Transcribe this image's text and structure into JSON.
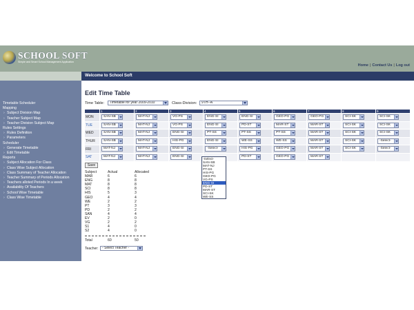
{
  "header": {
    "logo_name": "SCHOOL",
    "logo_name2": "SOFT",
    "tagline": "Simple and Smart School Management Application",
    "links": [
      "Home",
      "Contact Us",
      "Log out"
    ],
    "welcome": "Welcome to School Soft"
  },
  "sidebar": {
    "items": [
      {
        "label": "Timetable Scheduler",
        "level": 0
      },
      {
        "label": "Mapping",
        "level": 0
      },
      {
        "label": "Subject Division Map",
        "level": 1
      },
      {
        "label": "Teacher Subject Map",
        "level": 1
      },
      {
        "label": "Teacher Division Subject Map",
        "level": 1
      },
      {
        "label": "Rules Settings",
        "level": 0
      },
      {
        "label": "Rules Definition",
        "level": 1
      },
      {
        "label": "Parameters",
        "level": 1
      },
      {
        "label": "Scheduler",
        "level": 0
      },
      {
        "label": "Generate Timetable",
        "level": 1
      },
      {
        "label": "Edit Timetable",
        "level": 1
      },
      {
        "label": "Reports",
        "level": 0
      },
      {
        "label": "Subject Allocation For Class",
        "level": 1
      },
      {
        "label": "Class Wise Subject Allocation",
        "level": 1
      },
      {
        "label": "Class Summary of Teacher Allocation",
        "level": 1
      },
      {
        "label": "Teacher Summary of Periods Allocation",
        "level": 1
      },
      {
        "label": "Teachers alloted Periods In a week",
        "level": 1
      },
      {
        "label": "Availability Of Teachers",
        "level": 1
      },
      {
        "label": "School Wise Timetable",
        "level": 1
      },
      {
        "label": "Class Wise Timetable",
        "level": 1
      }
    ]
  },
  "main": {
    "title": "Edit Time Table",
    "timetable_label": "Time Table:",
    "timetable_value": "Timetable for year 2009-2010",
    "division_label": "Class-Division:",
    "division_value": "9TH--A",
    "periods": [
      "1",
      "2",
      "3",
      "4",
      "5",
      "6",
      "7",
      "8",
      "9"
    ],
    "rows": [
      {
        "day": "MON",
        "cells": [
          "SAN-SB",
          "MAT-NJ",
          "VG-PS",
          "ENG-SI",
          "ENG-SI",
          "GEO-PG",
          "GEO-PG",
          "SCI-SK",
          "SCI-SK"
        ]
      },
      {
        "day": "TUE",
        "cells": [
          "SAN-SB",
          "MAT-NJ",
          "VG-PS",
          "ENG-SI",
          "PD-ST",
          "MAR-ST",
          "MAR-ST",
          "SCI-SK",
          "SCI-SK"
        ]
      },
      {
        "day": "WED",
        "cells": [
          "SAN-SB",
          "MAT-NJ",
          "ENG-SI",
          "PT-SS",
          "PT-SS",
          "PT-SS",
          "MAR-ST",
          "SCI-SK",
          "SCI-SK"
        ]
      },
      {
        "day": "THUR",
        "cells": [
          "SAN-SB",
          "MAT-NJ",
          "HIS-PG",
          "ENG-SI",
          "WE-SS",
          "WE-SS",
          "MAR-ST",
          "SCI-SK",
          "-Select-"
        ]
      },
      {
        "day": "FRI",
        "cells": [
          "MAT-NJ",
          "MAT-NJ",
          "ENG-SI",
          "-Select-",
          "HIS-PG",
          "GEO-PG",
          "MAR-ST",
          "SCI-SK",
          "-Select-"
        ]
      },
      {
        "day": "SAT",
        "cells": [
          "MAT-NJ",
          "MAT-NJ",
          "ENG-SI",
          "",
          "PD-ST",
          "GEO-PG",
          "MAR-ST",
          "",
          ""
        ]
      }
    ],
    "dropdown_options": [
      "-Select-",
      "SAN-SB",
      "MAT-NJ",
      "PT-SS",
      "HIS-PG",
      "GEO-PG",
      "VG-PS",
      "ENG-SI",
      "PD-ST",
      "MAR-ST",
      "SCI-SK",
      "WE-SS"
    ],
    "dropdown_highlight": "ENG-SI",
    "save_label": "Save",
    "summary_headers": [
      "Subject",
      "Actual",
      "Allocated"
    ],
    "summary_rows": [
      [
        "MAR",
        "6",
        "6"
      ],
      [
        "ENG",
        "8",
        "8"
      ],
      [
        "MAT",
        "8",
        "8"
      ],
      [
        "SCI",
        "8",
        "8"
      ],
      [
        "HIS",
        "5",
        "3"
      ],
      [
        "GEO",
        "4",
        "4"
      ],
      [
        "WE",
        "2",
        "2"
      ],
      [
        "PT",
        "3",
        "3"
      ],
      [
        "PD",
        "2",
        "2"
      ],
      [
        "SAN",
        "4",
        "4"
      ],
      [
        "EV",
        "2",
        "0"
      ],
      [
        "VG",
        "2",
        "2"
      ],
      [
        "S1",
        "4",
        "0"
      ],
      [
        "S2",
        "4",
        "0"
      ]
    ],
    "total_label": "Total",
    "total_actual": "60",
    "total_allocated": "50",
    "teacher_label": "Teacher:",
    "teacher_value": "- Select Teacher -"
  },
  "colors": {
    "header_bg": "#9aaa9b",
    "nav_bar": "#2b3c67",
    "sidebar_bg": "#6f7fa0",
    "table_header": "#2e3f6e"
  }
}
